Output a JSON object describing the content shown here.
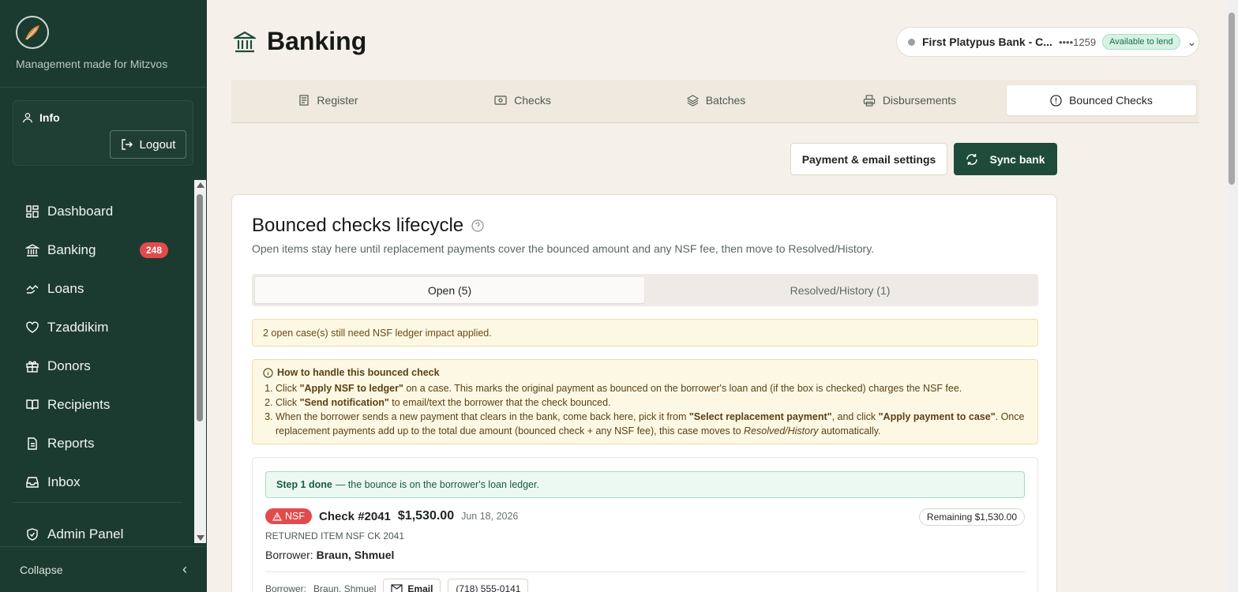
{
  "sidebar": {
    "tagline": "Management made for Mitzvos",
    "info_label": "Info",
    "logout_label": "Logout",
    "items": [
      {
        "label": "Dashboard",
        "icon": "dashboard-icon"
      },
      {
        "label": "Banking",
        "icon": "bank-icon",
        "badge": "248"
      },
      {
        "label": "Loans",
        "icon": "loans-icon"
      },
      {
        "label": "Tzaddikim",
        "icon": "heart-hand-icon"
      },
      {
        "label": "Donors",
        "icon": "gift-icon"
      },
      {
        "label": "Recipients",
        "icon": "book-icon"
      },
      {
        "label": "Reports",
        "icon": "report-icon"
      },
      {
        "label": "Inbox",
        "icon": "inbox-icon"
      },
      {
        "label": "Admin Panel",
        "icon": "shield-icon"
      }
    ],
    "collapse_label": "Collapse"
  },
  "header": {
    "title": "Banking",
    "bank": {
      "name": "First Platypus Bank - C...",
      "account": "••••1259",
      "status": "Available to lend"
    }
  },
  "tabs": [
    {
      "label": "Register",
      "icon": "register-icon"
    },
    {
      "label": "Checks",
      "icon": "check-icon"
    },
    {
      "label": "Batches",
      "icon": "layers-icon"
    },
    {
      "label": "Disbursements",
      "icon": "printer-icon"
    },
    {
      "label": "Bounced Checks",
      "icon": "alert-circle-icon",
      "active": true
    }
  ],
  "actions": {
    "settings_label": "Payment & email settings",
    "sync_label": "Sync bank"
  },
  "card": {
    "title": "Bounced checks lifecycle",
    "subtitle": "Open items stay here until replacement payments cover the bounced amount and any NSF fee, then move to Resolved/History.",
    "segments": [
      {
        "label": "Open (5)",
        "active": true
      },
      {
        "label": "Resolved/History (1)"
      }
    ],
    "warning": "2 open case(s) still need NSF ledger impact applied.",
    "howto": {
      "title": "How to handle this bounced check",
      "step1_pre": "Click ",
      "step1_bold": "\"Apply NSF to ledger\"",
      "step1_post": " on a case. This marks the original payment as bounced on the borrower's loan and (if the box is checked) charges the NSF fee.",
      "step2_pre": "Click ",
      "step2_bold": "\"Send notification\"",
      "step2_post": " to email/text the borrower that the check bounced.",
      "step3_a": "When the borrower sends a new payment that clears in the bank, come back here, pick it from ",
      "step3_b": "\"Select replacement payment\"",
      "step3_c": ", and click ",
      "step3_d": "\"Apply payment to case\"",
      "step3_e": ". Once replacement payments add up to the total due amount (bounced check + any NSF fee), this case moves to ",
      "step3_f": "Resolved/History",
      "step3_g": " automatically."
    },
    "case": {
      "step_done_bold": "Step 1 done",
      "step_done_text": "— the bounce is on the borrower's loan ledger.",
      "badge": "NSF",
      "check_no": "Check #2041",
      "amount": "$1,530.00",
      "date": "Jun 18, 2026",
      "remaining": "Remaining $1,530.00",
      "memo": "RETURNED ITEM NSF CK 2041",
      "borrower_label": "Borrower:",
      "borrower_name": "Braun, Shmuel",
      "contact_label": "Borrower:",
      "contact_name": "Braun, Shmuel",
      "email_label": "Email",
      "phone": "(718) 555-0141"
    }
  },
  "colors": {
    "sidebar_bg": "#1c3b30",
    "primary": "#1e4b3a",
    "danger": "#e24b4b",
    "page_bg": "#f5f1ea"
  }
}
